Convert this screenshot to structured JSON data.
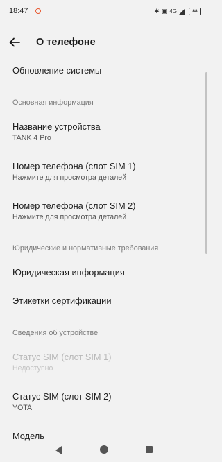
{
  "status_bar": {
    "time": "18:47",
    "network_label": "4G",
    "battery": "88"
  },
  "header": {
    "title": "О телефоне"
  },
  "items": {
    "system_update": {
      "title": "Обновление системы"
    },
    "section_basic": "Основная информация",
    "device_name": {
      "title": "Название устройства",
      "sub": "TANK 4 Pro"
    },
    "phone_sim1": {
      "title": "Номер телефона (слот SIM 1)",
      "sub": "Нажмите для просмотра деталей"
    },
    "phone_sim2": {
      "title": "Номер телефона (слот SIM 2)",
      "sub": "Нажмите для просмотра деталей"
    },
    "section_legal": "Юридические и нормативные требования",
    "legal_info": {
      "title": "Юридическая информация"
    },
    "cert_labels": {
      "title": "Этикетки сертификации"
    },
    "section_device": "Сведения об устройстве",
    "sim1_status": {
      "title": "Статус SIM (слот SIM 1)",
      "sub": "Недоступно"
    },
    "sim2_status": {
      "title": "Статус SIM (слот SIM 2)",
      "sub": "YOTA"
    },
    "model": {
      "title": "Модель"
    }
  },
  "colors": {
    "background": "#f2f2f2",
    "notification_dot": "#e8572e",
    "disabled_text": "#b9b9b9"
  },
  "icons": {
    "back": "arrow-left-icon",
    "nav_back": "triangle-back-icon",
    "nav_home": "circle-home-icon",
    "nav_recents": "square-recents-icon"
  }
}
